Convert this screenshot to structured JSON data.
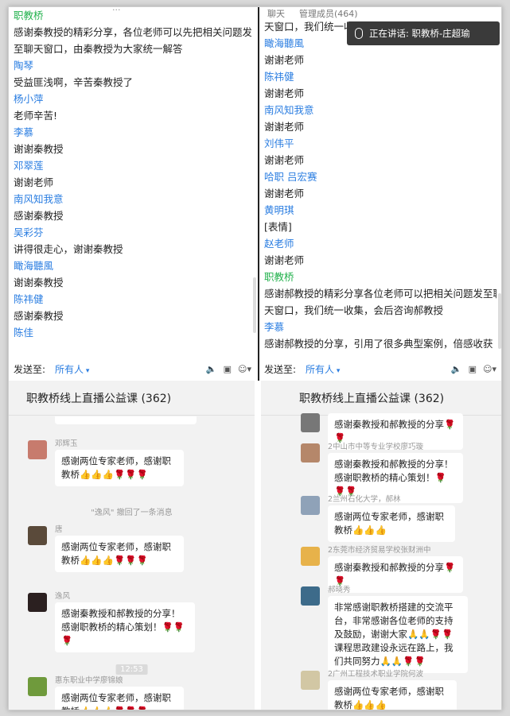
{
  "left_panel": {
    "top_cut_text": "...",
    "messages": [
      {
        "type": "name",
        "color": "green",
        "text": "职教桥"
      },
      {
        "type": "msg",
        "text": "感谢秦教授的精彩分享，各位老师可以先把相关问题发"
      },
      {
        "type": "msg",
        "text": "至聊天窗口，由秦教授为大家统一解答"
      },
      {
        "type": "name",
        "text": "陶琴"
      },
      {
        "type": "msg",
        "text": "受益匪浅啊，辛苦秦教授了"
      },
      {
        "type": "name",
        "text": "杨小萍"
      },
      {
        "type": "msg",
        "text": "老师辛苦!"
      },
      {
        "type": "name",
        "text": "李慕"
      },
      {
        "type": "msg",
        "text": "谢谢秦教授"
      },
      {
        "type": "name",
        "text": "邓翠莲"
      },
      {
        "type": "msg",
        "text": "谢谢老师"
      },
      {
        "type": "name",
        "text": "南风知我意"
      },
      {
        "type": "msg",
        "text": "感谢秦教授"
      },
      {
        "type": "name",
        "text": "吴彩芬"
      },
      {
        "type": "msg",
        "text": "讲得很走心，谢谢秦教授"
      },
      {
        "type": "name",
        "text": "瞰海聽風"
      },
      {
        "type": "msg",
        "text": "谢谢秦教授"
      },
      {
        "type": "name",
        "text": "陈祎健"
      },
      {
        "type": "msg",
        "text": "感谢秦教授"
      },
      {
        "type": "name",
        "text": "陈佳"
      }
    ],
    "send_label": "发送至:",
    "send_target": "所有人"
  },
  "right_panel": {
    "top_tabs": [
      "聊天",
      "管理成员(464)"
    ],
    "speaker_text": "正在讲话: 职教桥-庄超瑜",
    "messages": [
      {
        "type": "msg",
        "text": "天窗口，我们统一收集..."
      },
      {
        "type": "name",
        "text": "瞰海聽風"
      },
      {
        "type": "msg",
        "text": "谢谢老师"
      },
      {
        "type": "name",
        "text": "陈祎健"
      },
      {
        "type": "msg",
        "text": "谢谢老师"
      },
      {
        "type": "name",
        "text": "南风知我意"
      },
      {
        "type": "msg",
        "text": "谢谢老师"
      },
      {
        "type": "name",
        "text": "刘伟平"
      },
      {
        "type": "msg",
        "text": "谢谢老师"
      },
      {
        "type": "name",
        "text": "哈职  吕宏赛"
      },
      {
        "type": "msg",
        "text": "谢谢老师"
      },
      {
        "type": "name",
        "text": "黄明琪"
      },
      {
        "type": "msg",
        "text": "[表情]"
      },
      {
        "type": "name",
        "text": "赵老师"
      },
      {
        "type": "msg",
        "text": "谢谢老师"
      },
      {
        "type": "name",
        "color": "green",
        "text": "职教桥"
      },
      {
        "type": "msg",
        "text": "感谢郝教授的精彩分享各位老师可以把相关问题发至聊"
      },
      {
        "type": "msg",
        "text": "天窗口，我们统一收集，会后咨询郝教授"
      },
      {
        "type": "name",
        "text": "李慕"
      },
      {
        "type": "msg",
        "text": "感谢郝教授的分享，引用了很多典型案例，倍感收获"
      }
    ],
    "send_label": "发送至:",
    "send_target": "所有人"
  },
  "wechat_left": {
    "title": "职教桥线上直播公益课 (362)",
    "items": [
      {
        "kind": "msg",
        "sender": "邓辉玉",
        "avatar_color": "#c77b6d",
        "text": "感谢两位专家老师，感谢职教桥👍👍👍🌹🌹🌹"
      },
      {
        "kind": "sys",
        "text": "\"逸风\" 撤回了一条消息"
      },
      {
        "kind": "msg",
        "sender": "唐",
        "avatar_color": "#5a4a3a",
        "text": "感谢两位专家老师，感谢职教桥👍👍👍🌹🌹🌹"
      },
      {
        "kind": "msg",
        "sender": "逸风",
        "avatar_color": "#2b2020",
        "text": "感谢秦教授和郝教授的分享！感谢职教桥的精心策划！🌹🌹🌹"
      },
      {
        "kind": "time",
        "text": "12:53"
      },
      {
        "kind": "msg",
        "sender": "惠东职业中学廖锦娘",
        "avatar_color": "#6f9a3c",
        "text": "感谢两位专家老师，感谢职教桥👍👍👍🌹🌹🌹"
      }
    ]
  },
  "wechat_right": {
    "title": "职教桥线上直播公益课 (362)",
    "items": [
      {
        "kind": "msg",
        "sender": "",
        "avatar_color": "#777",
        "text": "感谢秦教授和郝教授的分享🌹🌹"
      },
      {
        "kind": "msg",
        "sender": "2中山市中等专业学校廖巧璇",
        "avatar_color": "#b5876a",
        "text": "感谢秦教授和郝教授的分享！感谢职教桥的精心策划！🌹🌹🌹"
      },
      {
        "kind": "msg",
        "sender": "2兰州石化大学，郝林",
        "avatar_color": "#8fa2b8",
        "text": "感谢两位专家老师，感谢职教桥👍👍👍"
      },
      {
        "kind": "msg",
        "sender": "2东莞市经济贸易学校张财洲中",
        "avatar_color": "#e7b24a",
        "text": "感谢秦教授和郝教授的分享🌹🌹"
      },
      {
        "kind": "msg",
        "sender": "郝晓秀",
        "avatar_color": "#3d6b8a",
        "text": "非常感谢职教桥搭建的交流平台，非常感谢各位老师的支持及鼓励，谢谢大家🙏🙏🌹🌹课程思政建设永远在路上，我们共同努力🙏🙏🌹🌹"
      },
      {
        "kind": "msg",
        "sender": "2广州工程技术职业学院何波",
        "avatar_color": "#d2c7a4",
        "text": "感谢两位专家老师，感谢职教桥👍👍👍"
      }
    ]
  }
}
